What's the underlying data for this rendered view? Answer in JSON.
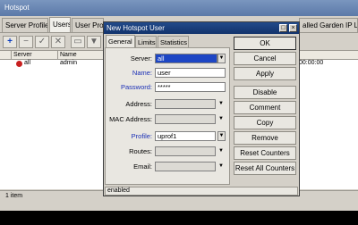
{
  "window": {
    "title": "Hotspot",
    "tabs": [
      "Server Profiles",
      "Users",
      "User Profil",
      "alled Garden IP List"
    ],
    "status": "1 item"
  },
  "list": {
    "columns": [
      "Server",
      "Name"
    ],
    "rows": [
      {
        "server": "all",
        "name": "admin",
        "tail": "00:00:00"
      }
    ]
  },
  "dialog": {
    "title": "New Hotspot User",
    "tabs": [
      "General",
      "Limits",
      "Statistics"
    ],
    "fields": {
      "server": {
        "label": "Server:",
        "value": "all"
      },
      "name": {
        "label": "Name:",
        "value": "user"
      },
      "password": {
        "label": "Password:",
        "value": "*****"
      },
      "address": {
        "label": "Address:",
        "value": ""
      },
      "mac": {
        "label": "MAC Address:",
        "value": ""
      },
      "profile": {
        "label": "Profile:",
        "value": "uprof1"
      },
      "routes": {
        "label": "Routes:",
        "value": ""
      },
      "email": {
        "label": "Email:",
        "value": ""
      }
    },
    "buttons": [
      "OK",
      "Cancel",
      "Apply",
      "Disable",
      "Comment",
      "Copy",
      "Remove",
      "Reset Counters",
      "Reset All Counters"
    ],
    "status": "enabled"
  },
  "colors": {
    "titlebar_dialog": "#12336c",
    "selection": "#1d46c4",
    "label_blue": "#1a2fb6",
    "panel": "#d4d0c8"
  }
}
